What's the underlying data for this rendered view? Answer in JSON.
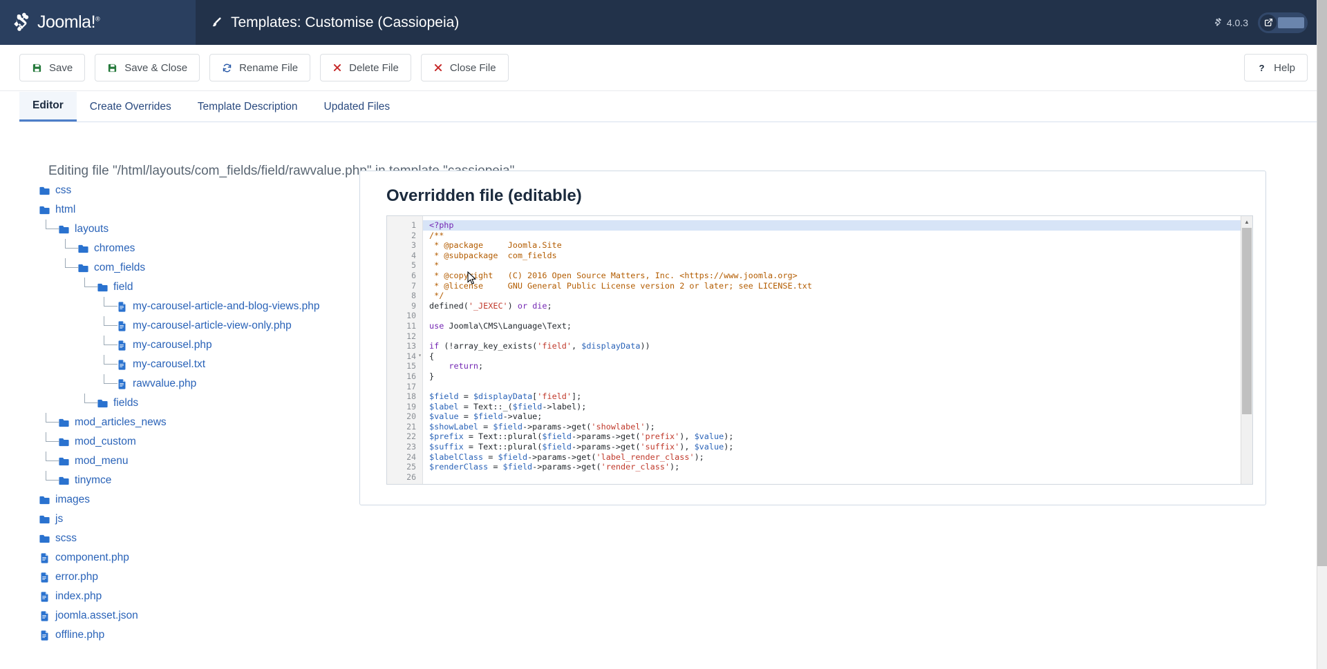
{
  "header": {
    "brand_name": "Joomla!",
    "brand_reg": "®",
    "page_title": "Templates: Customise (Cassiopeia)",
    "brush_icon": "brush-icon",
    "version": "4.0.3",
    "preview_toggle_icon": "external-link-icon"
  },
  "toolbar": {
    "buttons": [
      {
        "label": "Save",
        "icon": "save-disk-icon",
        "color": "#267a3c"
      },
      {
        "label": "Save & Close",
        "icon": "save-disk-icon",
        "color": "#267a3c"
      },
      {
        "label": "Rename File",
        "icon": "refresh-sync-icon",
        "color": "#2a5aa8"
      },
      {
        "label": "Delete File",
        "icon": "x-mark-icon",
        "color": "#c62828"
      },
      {
        "label": "Close File",
        "icon": "x-mark-icon",
        "color": "#c62828"
      }
    ],
    "help": {
      "label": "Help",
      "icon": "question-mark-icon"
    }
  },
  "tabs": [
    {
      "label": "Editor",
      "active": true
    },
    {
      "label": "Create Overrides",
      "active": false
    },
    {
      "label": "Template Description",
      "active": false
    },
    {
      "label": "Updated Files",
      "active": false
    }
  ],
  "main": {
    "editing_note": "Editing file \"/html/layouts/com_fields/field/rawvalue.php\" in template \"cassiopeia\".",
    "editor_panel_title": "Overridden file (editable)"
  },
  "filetree": [
    {
      "label": "css",
      "type": "folder",
      "depth": 0,
      "elbow": false
    },
    {
      "label": "html",
      "type": "folder",
      "depth": 0,
      "elbow": false
    },
    {
      "label": "layouts",
      "type": "folder",
      "depth": 1,
      "elbow": true
    },
    {
      "label": "chromes",
      "type": "folder",
      "depth": 2,
      "elbow": true
    },
    {
      "label": "com_fields",
      "type": "folder",
      "depth": 2,
      "elbow": true
    },
    {
      "label": "field",
      "type": "folder",
      "depth": 3,
      "elbow": true
    },
    {
      "label": "my-carousel-article-and-blog-views.php",
      "type": "file",
      "depth": 4,
      "elbow": true
    },
    {
      "label": "my-carousel-article-view-only.php",
      "type": "file",
      "depth": 4,
      "elbow": true
    },
    {
      "label": "my-carousel.php",
      "type": "file",
      "depth": 4,
      "elbow": true
    },
    {
      "label": "my-carousel.txt",
      "type": "file",
      "depth": 4,
      "elbow": true
    },
    {
      "label": "rawvalue.php",
      "type": "file",
      "depth": 4,
      "elbow": true
    },
    {
      "label": "fields",
      "type": "folder",
      "depth": 3,
      "elbow": true
    },
    {
      "label": "mod_articles_news",
      "type": "folder",
      "depth": 1,
      "elbow": true
    },
    {
      "label": "mod_custom",
      "type": "folder",
      "depth": 1,
      "elbow": true
    },
    {
      "label": "mod_menu",
      "type": "folder",
      "depth": 1,
      "elbow": true
    },
    {
      "label": "tinymce",
      "type": "folder",
      "depth": 1,
      "elbow": true
    },
    {
      "label": "images",
      "type": "folder",
      "depth": 0,
      "elbow": false
    },
    {
      "label": "js",
      "type": "folder",
      "depth": 0,
      "elbow": false
    },
    {
      "label": "scss",
      "type": "folder",
      "depth": 0,
      "elbow": false
    },
    {
      "label": "component.php",
      "type": "file",
      "depth": 0,
      "elbow": false
    },
    {
      "label": "error.php",
      "type": "file",
      "depth": 0,
      "elbow": false
    },
    {
      "label": "index.php",
      "type": "file",
      "depth": 0,
      "elbow": false
    },
    {
      "label": "joomla.asset.json",
      "type": "file",
      "depth": 0,
      "elbow": false
    },
    {
      "label": "offline.php",
      "type": "file",
      "depth": 0,
      "elbow": false
    }
  ],
  "code": {
    "highlight_line": 1,
    "fold_lines": [
      14
    ],
    "lines": [
      {
        "n": 1,
        "tokens": [
          {
            "t": "<?php",
            "c": "tok-kw"
          }
        ]
      },
      {
        "n": 2,
        "tokens": [
          {
            "t": "/**",
            "c": "tok-cmt"
          }
        ]
      },
      {
        "n": 3,
        "tokens": [
          {
            "t": " * @package     Joomla.Site",
            "c": "tok-cmt"
          }
        ]
      },
      {
        "n": 4,
        "tokens": [
          {
            "t": " * @subpackage  com_fields",
            "c": "tok-cmt"
          }
        ]
      },
      {
        "n": 5,
        "tokens": [
          {
            "t": " *",
            "c": "tok-cmt"
          }
        ]
      },
      {
        "n": 6,
        "tokens": [
          {
            "t": " * @copyright   (C) 2016 Open Source Matters, Inc. <https://www.joomla.org>",
            "c": "tok-cmt"
          }
        ]
      },
      {
        "n": 7,
        "tokens": [
          {
            "t": " * @license     GNU General Public License version 2 or later; see LICENSE.txt",
            "c": "tok-cmt"
          }
        ]
      },
      {
        "n": 8,
        "tokens": [
          {
            "t": " */",
            "c": "tok-cmt"
          }
        ]
      },
      {
        "n": 9,
        "tokens": [
          {
            "t": "defined",
            "c": "tok-fn"
          },
          {
            "t": "(",
            "c": "tok-pun"
          },
          {
            "t": "'_JEXEC'",
            "c": "tok-str"
          },
          {
            "t": ") ",
            "c": "tok-pun"
          },
          {
            "t": "or",
            "c": "tok-kw"
          },
          {
            "t": " ",
            "c": "tok-pun"
          },
          {
            "t": "die",
            "c": "tok-kw"
          },
          {
            "t": ";",
            "c": "tok-pun"
          }
        ]
      },
      {
        "n": 10,
        "tokens": [
          {
            "t": "",
            "c": "tok-pun"
          }
        ]
      },
      {
        "n": 11,
        "tokens": [
          {
            "t": "use",
            "c": "tok-kw"
          },
          {
            "t": " Joomla\\CMS\\Language\\Text;",
            "c": "tok-pun"
          }
        ]
      },
      {
        "n": 12,
        "tokens": [
          {
            "t": "",
            "c": "tok-pun"
          }
        ]
      },
      {
        "n": 13,
        "tokens": [
          {
            "t": "if",
            "c": "tok-kw"
          },
          {
            "t": " (!",
            "c": "tok-pun"
          },
          {
            "t": "array_key_exists",
            "c": "tok-fn"
          },
          {
            "t": "(",
            "c": "tok-pun"
          },
          {
            "t": "'field'",
            "c": "tok-str"
          },
          {
            "t": ", ",
            "c": "tok-pun"
          },
          {
            "t": "$displayData",
            "c": "tok-var"
          },
          {
            "t": "))",
            "c": "tok-pun"
          }
        ]
      },
      {
        "n": 14,
        "tokens": [
          {
            "t": "{",
            "c": "tok-pun"
          }
        ]
      },
      {
        "n": 15,
        "tokens": [
          {
            "t": "    ",
            "c": "tok-pun"
          },
          {
            "t": "return",
            "c": "tok-kw"
          },
          {
            "t": ";",
            "c": "tok-pun"
          }
        ]
      },
      {
        "n": 16,
        "tokens": [
          {
            "t": "}",
            "c": "tok-pun"
          }
        ]
      },
      {
        "n": 17,
        "tokens": [
          {
            "t": "",
            "c": "tok-pun"
          }
        ]
      },
      {
        "n": 18,
        "tokens": [
          {
            "t": "$field",
            "c": "tok-var"
          },
          {
            "t": " = ",
            "c": "tok-pun"
          },
          {
            "t": "$displayData",
            "c": "tok-var"
          },
          {
            "t": "[",
            "c": "tok-pun"
          },
          {
            "t": "'field'",
            "c": "tok-str"
          },
          {
            "t": "];",
            "c": "tok-pun"
          }
        ]
      },
      {
        "n": 19,
        "tokens": [
          {
            "t": "$label",
            "c": "tok-var"
          },
          {
            "t": " = ",
            "c": "tok-pun"
          },
          {
            "t": "Text",
            "c": "tok-fn"
          },
          {
            "t": "::_(",
            "c": "tok-pun"
          },
          {
            "t": "$field",
            "c": "tok-var"
          },
          {
            "t": "->label);",
            "c": "tok-pun"
          }
        ]
      },
      {
        "n": 20,
        "tokens": [
          {
            "t": "$value",
            "c": "tok-var"
          },
          {
            "t": " = ",
            "c": "tok-pun"
          },
          {
            "t": "$field",
            "c": "tok-var"
          },
          {
            "t": "->value;",
            "c": "tok-pun"
          }
        ]
      },
      {
        "n": 21,
        "tokens": [
          {
            "t": "$showLabel",
            "c": "tok-var"
          },
          {
            "t": " = ",
            "c": "tok-pun"
          },
          {
            "t": "$field",
            "c": "tok-var"
          },
          {
            "t": "->params->get(",
            "c": "tok-pun"
          },
          {
            "t": "'showlabel'",
            "c": "tok-str"
          },
          {
            "t": ");",
            "c": "tok-pun"
          }
        ]
      },
      {
        "n": 22,
        "tokens": [
          {
            "t": "$prefix",
            "c": "tok-var"
          },
          {
            "t": " = ",
            "c": "tok-pun"
          },
          {
            "t": "Text",
            "c": "tok-fn"
          },
          {
            "t": "::plural(",
            "c": "tok-pun"
          },
          {
            "t": "$field",
            "c": "tok-var"
          },
          {
            "t": "->params->get(",
            "c": "tok-pun"
          },
          {
            "t": "'prefix'",
            "c": "tok-str"
          },
          {
            "t": "), ",
            "c": "tok-pun"
          },
          {
            "t": "$value",
            "c": "tok-var"
          },
          {
            "t": ");",
            "c": "tok-pun"
          }
        ]
      },
      {
        "n": 23,
        "tokens": [
          {
            "t": "$suffix",
            "c": "tok-var"
          },
          {
            "t": " = ",
            "c": "tok-pun"
          },
          {
            "t": "Text",
            "c": "tok-fn"
          },
          {
            "t": "::plural(",
            "c": "tok-pun"
          },
          {
            "t": "$field",
            "c": "tok-var"
          },
          {
            "t": "->params->get(",
            "c": "tok-pun"
          },
          {
            "t": "'suffix'",
            "c": "tok-str"
          },
          {
            "t": "), ",
            "c": "tok-pun"
          },
          {
            "t": "$value",
            "c": "tok-var"
          },
          {
            "t": ");",
            "c": "tok-pun"
          }
        ]
      },
      {
        "n": 24,
        "tokens": [
          {
            "t": "$labelClass",
            "c": "tok-var"
          },
          {
            "t": " = ",
            "c": "tok-pun"
          },
          {
            "t": "$field",
            "c": "tok-var"
          },
          {
            "t": "->params->get(",
            "c": "tok-pun"
          },
          {
            "t": "'label_render_class'",
            "c": "tok-str"
          },
          {
            "t": ");",
            "c": "tok-pun"
          }
        ]
      },
      {
        "n": 25,
        "tokens": [
          {
            "t": "$renderClass",
            "c": "tok-var"
          },
          {
            "t": " = ",
            "c": "tok-pun"
          },
          {
            "t": "$field",
            "c": "tok-var"
          },
          {
            "t": "->params->get(",
            "c": "tok-pun"
          },
          {
            "t": "'render_class'",
            "c": "tok-str"
          },
          {
            "t": ");",
            "c": "tok-pun"
          }
        ]
      },
      {
        "n": 26,
        "tokens": [
          {
            "t": "",
            "c": "tok-pun"
          }
        ]
      }
    ]
  },
  "colors": {
    "header_bg": "#22324a",
    "brand_bg": "#2a3f5f",
    "link_blue": "#2a63b8",
    "tab_active_underline": "#4d7ec8",
    "save_green": "#267a3c",
    "delete_red": "#c62828"
  }
}
